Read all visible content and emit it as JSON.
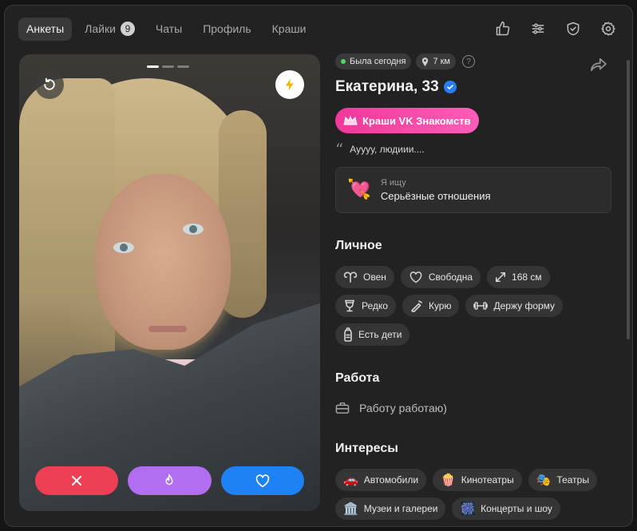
{
  "nav": {
    "tabs": [
      {
        "label": "Анкеты",
        "active": true
      },
      {
        "label": "Лайки",
        "badge": "9"
      },
      {
        "label": "Чаты"
      },
      {
        "label": "Профиль"
      },
      {
        "label": "Краши"
      }
    ],
    "icons": [
      "thumbs-up-icon",
      "filters-icon",
      "shield-check-icon",
      "gear-icon"
    ]
  },
  "photo": {
    "indicator_count": 3,
    "active_index": 0
  },
  "profile": {
    "status": "Была сегодня",
    "distance": "7 км",
    "name_age": "Екатерина, 33",
    "crush_label": "Краши VK Знакомств",
    "quote": "Ауууу, людиии....",
    "looking_label": "Я ищу",
    "looking_value": "Серьёзные отношения"
  },
  "personal": {
    "title": "Личное",
    "tags": [
      "Овен",
      "Свободна",
      "168 см",
      "Редко",
      "Курю",
      "Держу форму",
      "Есть дети"
    ]
  },
  "work": {
    "title": "Работа",
    "value": "Работу работаю)"
  },
  "interests": {
    "title": "Интересы",
    "tags": [
      {
        "emoji": "🚗",
        "label": "Автомобили"
      },
      {
        "emoji": "🍿",
        "label": "Кинотеатры"
      },
      {
        "emoji": "🎭",
        "label": "Театры"
      },
      {
        "emoji": "🏛️",
        "label": "Музеи и галереи"
      },
      {
        "emoji": "🎆",
        "label": "Концерты и шоу"
      }
    ]
  },
  "colors": {
    "accent_pink": "#f0389a",
    "dislike": "#ef3f55",
    "superlike": "#b36df0",
    "like": "#1e82f5",
    "online": "#4cd964"
  }
}
